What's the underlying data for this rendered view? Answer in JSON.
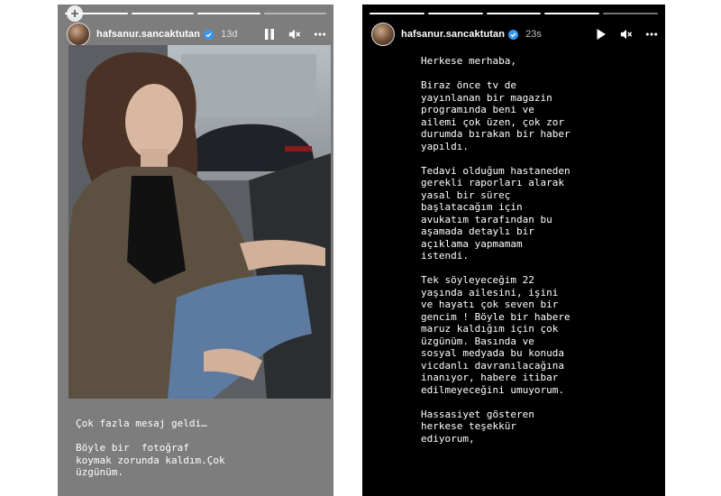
{
  "left_story": {
    "username": "hafsanur.sancaktutan",
    "time": "13d",
    "caption": "Çok fazla mesaj geldi…\n\nBöyle bir  fotoğraf\nkoymak zorunda kaldım.Çok\nüzgünüm.",
    "progress_segments": 4,
    "progress_done": 3
  },
  "right_story": {
    "username": "hafsanur.sancaktutan",
    "time": "23s",
    "message": "Herkese merhaba,\n\nBiraz önce tv de\nyayınlanan bir magazin\nprogramında beni ve\nailemi çok üzen, çok zor\ndurumda bırakan bir haber\nyapıldı.\n\nTedavi olduğum hastaneden\ngerekli raporları alarak\nyasal bir süreç\nbaşlatacağım için\navukatım tarafından bu\naşamada detaylı bir\naçıklama yapmamam\nistendi.\n\nTek söyleyeceğim 22\nyaşında ailesini, işini\nve hayatı çok seven bir\ngencim ! Böyle bir habere\nmaruz kaldığım için çok\nüzgünüm. Basında ve\nsosyal medyada bu konuda\nvicdanlı davranılacağına\ninanıyor, habere itibar\nedilmeyeceğini umuyorum.\n\nHassasiyet gösteren\nherkese teşekkür\nediyorum,",
    "progress_segments": 5,
    "progress_done": 4
  },
  "icons": {
    "verified": "verified-badge-icon",
    "pause": "pause-icon",
    "play": "play-icon",
    "mute": "speaker-muted-icon",
    "more": "more-options-icon",
    "add": "plus-icon"
  },
  "colors": {
    "left_bg": "#7d7d7d",
    "right_bg": "#000000",
    "verified_blue": "#3897f0"
  }
}
